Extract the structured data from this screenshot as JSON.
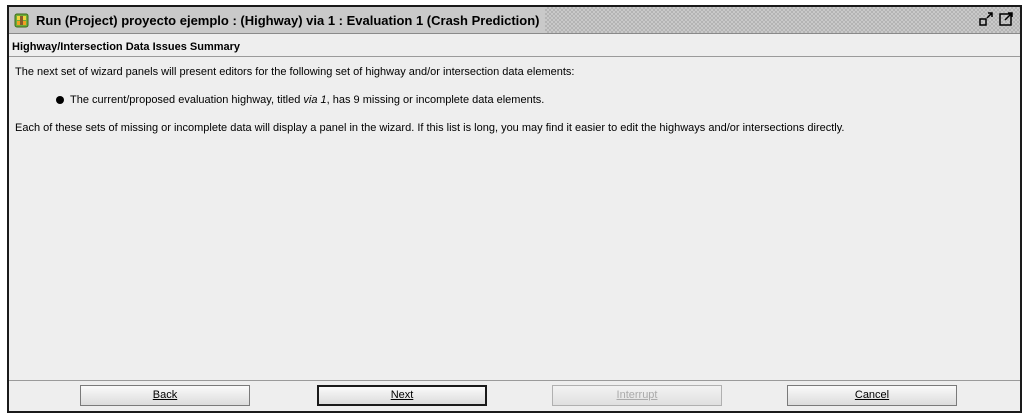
{
  "window": {
    "title": "Run (Project) proyecto ejemplo : (Highway) via 1 : Evaluation 1 (Crash Prediction)",
    "icons": [
      "app-icon",
      "minimize-icon",
      "maximize-icon"
    ]
  },
  "panel": {
    "header": "Highway/Intersection Data Issues Summary",
    "intro": "The next set of wizard panels will present editors for the following set of highway and/or intersection data elements:",
    "bullet": {
      "prefix": "The current/proposed evaluation highway, titled ",
      "highway_name": "via 1",
      "suffix": ", has 9 missing or incomplete data elements."
    },
    "footer_note": "Each of these sets of missing or incomplete data will display a panel in the wizard. If this list is long, you may find it easier to edit the highways and/or intersections directly."
  },
  "buttons": {
    "back": "Back",
    "next": "Next",
    "interrupt": "Interrupt",
    "cancel": "Cancel"
  },
  "colors": {
    "window_bg": "#eeeeee",
    "titlebar_bg": "#c9c9c9",
    "disabled_text": "#aaaaaa"
  }
}
